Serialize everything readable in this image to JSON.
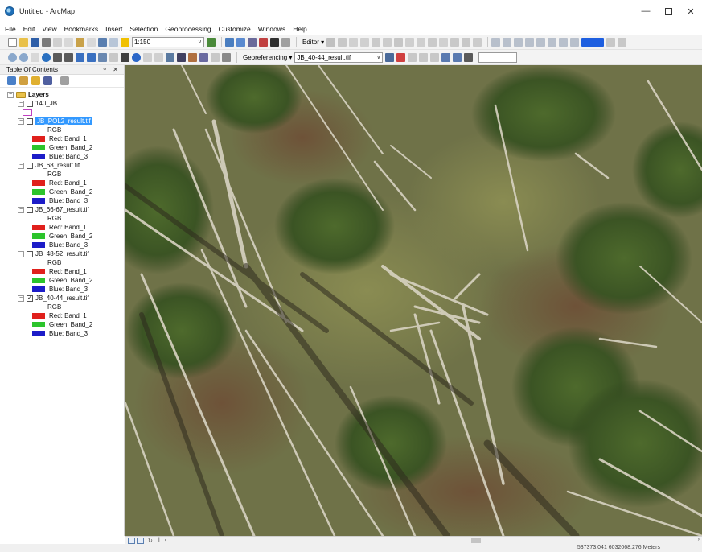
{
  "window": {
    "title": "Untitled - ArcMap",
    "min_glyph": "—",
    "close_glyph": "✕"
  },
  "menu": [
    "File",
    "Edit",
    "View",
    "Bookmarks",
    "Insert",
    "Selection",
    "Geoprocessing",
    "Customize",
    "Windows",
    "Help"
  ],
  "toolbar": {
    "scale": "1:150",
    "editor_label": "Editor ▾",
    "georef_label": "Georeferencing ▾",
    "georef_layer": "JB_40-44_result.tif"
  },
  "toc": {
    "title": "Table Of Contents",
    "controls": "ᵠ ✕",
    "root_label": "Layers",
    "layers": [
      {
        "name": "140_JB",
        "checked": false,
        "type": "polygon"
      },
      {
        "name": "JB_POL2_result.tif",
        "checked": false,
        "selected": true,
        "type": "raster",
        "bands": [
          "Red:  Band_1",
          "Green: Band_2",
          "Blue:  Band_3"
        ]
      },
      {
        "name": "JB_68_result.tif",
        "checked": false,
        "type": "raster",
        "bands": [
          "Red:  Band_1",
          "Green: Band_2",
          "Blue:  Band_3"
        ]
      },
      {
        "name": "JB_66-67_result.tif",
        "checked": false,
        "type": "raster",
        "bands": [
          "Red:  Band_1",
          "Green: Band_2",
          "Blue:  Band_3"
        ]
      },
      {
        "name": "JB_48-52_result.tif",
        "checked": false,
        "type": "raster",
        "bands": [
          "Red:  Band_1",
          "Green: Band_2",
          "Blue:  Band_3"
        ]
      },
      {
        "name": "JB_40-44_result.tif",
        "checked": true,
        "type": "raster",
        "bands": [
          "Red:  Band_1",
          "Green: Band_2",
          "Blue:  Band_3"
        ]
      }
    ],
    "rgb_label": "RGB"
  },
  "colors": {
    "red_band": "#e0201c",
    "green_band": "#2cc42c",
    "blue_band": "#1c1cc8",
    "selection": "#3399ff",
    "blue_swatch_toolbar": "#1e5fe0"
  },
  "status": {
    "coordinates": "537373.041  6032068.276 Meters"
  }
}
